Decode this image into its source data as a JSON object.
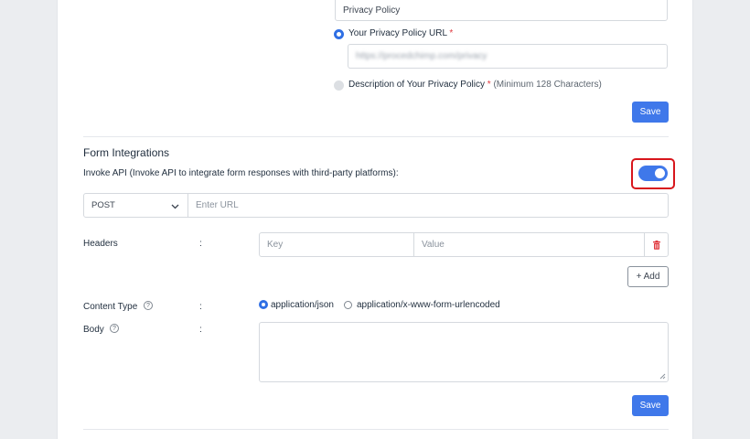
{
  "privacy": {
    "title_value": "Privacy Policy",
    "url_option_label": "Your Privacy Policy URL",
    "required_mark": "*",
    "url_value": "https://procedchimp.com/privacy",
    "description_option_label": "Description of Your Privacy Policy",
    "description_hint": "(Minimum 128 Characters)",
    "save_label": "Save"
  },
  "form_integrations": {
    "title": "Form Integrations",
    "invoke_api_label": "Invoke API (Invoke API to integrate form responses with third-party platforms):",
    "invoke_api_enabled": true,
    "method_value": "POST",
    "url_placeholder": "Enter URL",
    "headers_label": "Headers",
    "colon": ":",
    "key_placeholder": "Key",
    "value_placeholder": "Value",
    "add_label": "+ Add",
    "content_type_label": "Content Type",
    "content_type_options": [
      "application/json",
      "application/x-www-form-urlencoded"
    ],
    "content_type_selected": "application/json",
    "body_label": "Body",
    "save_label": "Save"
  },
  "colors": {
    "accent": "#3f78ea",
    "highlight_frame": "#d8161c",
    "delete_icon": "#e0383e"
  },
  "icons": [
    "chevron-down-icon",
    "trash-icon",
    "help-icon",
    "resize-handle-icon"
  ]
}
